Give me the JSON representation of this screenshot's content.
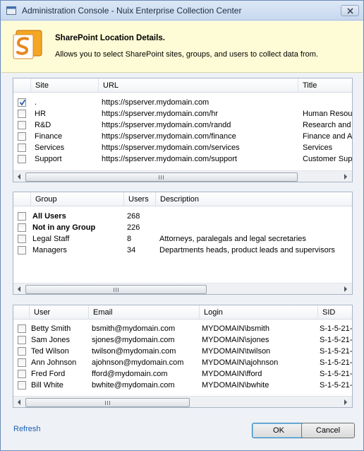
{
  "window": {
    "title": "Administration Console - Nuix Enterprise Collection Center"
  },
  "banner": {
    "heading": "SharePoint Location Details.",
    "description": "Allows you to select SharePoint sites, groups, and users to collect data from.",
    "icon": "sharepoint-icon"
  },
  "sites": {
    "columns": [
      "Site",
      "URL",
      "Title"
    ],
    "rows": [
      {
        "checked": true,
        "site": ".",
        "url": "https://spserver.mydomain.com",
        "title": ""
      },
      {
        "checked": false,
        "site": "HR",
        "url": "https://spserver.mydomain.com/hr",
        "title": "Human Resou"
      },
      {
        "checked": false,
        "site": "R&D",
        "url": "https://spserver.mydomain.com/randd",
        "title": "Research and"
      },
      {
        "checked": false,
        "site": "Finance",
        "url": "https://spserver.mydomain.com/finance",
        "title": "Finance and A"
      },
      {
        "checked": false,
        "site": "Services",
        "url": "https://spserver.mydomain.com/services",
        "title": "Services"
      },
      {
        "checked": false,
        "site": "Support",
        "url": "https://spserver.mydomain.com/support",
        "title": "Customer Sup"
      }
    ]
  },
  "groups": {
    "columns": [
      "Group",
      "Users",
      "Description"
    ],
    "rows": [
      {
        "checked": false,
        "bold": true,
        "group": "All Users",
        "users": "268",
        "description": ""
      },
      {
        "checked": false,
        "bold": true,
        "group": "Not in any Group",
        "users": "226",
        "description": ""
      },
      {
        "checked": false,
        "bold": false,
        "group": "Legal Staff",
        "users": "8",
        "description": "Attorneys, paralegals and legal secretaries"
      },
      {
        "checked": false,
        "bold": false,
        "group": "Managers",
        "users": "34",
        "description": "Departments heads, product leads and supervisors"
      }
    ]
  },
  "users": {
    "columns": [
      "User",
      "Email",
      "Login",
      "SID"
    ],
    "rows": [
      {
        "checked": false,
        "user": "Betty Smith",
        "email": "bsmith@mydomain.com",
        "login": "MYDOMAIN\\bsmith",
        "sid": "S-1-5-21-"
      },
      {
        "checked": false,
        "user": "Sam Jones",
        "email": "sjones@mydomain.com",
        "login": "MYDOMAIN\\sjones",
        "sid": "S-1-5-21-"
      },
      {
        "checked": false,
        "user": "Ted Wilson",
        "email": "twilson@mydomain.com",
        "login": "MYDOMAIN\\twilson",
        "sid": "S-1-5-21-"
      },
      {
        "checked": false,
        "user": "Ann Johnson",
        "email": "ajohnson@mydomain.com",
        "login": "MYDOMAIN\\ajohnson",
        "sid": "S-1-5-21-"
      },
      {
        "checked": false,
        "user": "Fred Ford",
        "email": "fford@mydomain.com",
        "login": "MYDOMAIN\\fford",
        "sid": "S-1-5-21-"
      },
      {
        "checked": false,
        "user": "Bill White",
        "email": "bwhite@mydomain.com",
        "login": "MYDOMAIN\\bwhite",
        "sid": "S-1-5-21-"
      }
    ]
  },
  "footer": {
    "refresh_label": "Refresh",
    "ok_label": "OK",
    "cancel_label": "Cancel"
  },
  "colors": {
    "banner_bg": "#fefcd6",
    "link": "#1a5fb4",
    "window_border": "#6d8bb5"
  }
}
